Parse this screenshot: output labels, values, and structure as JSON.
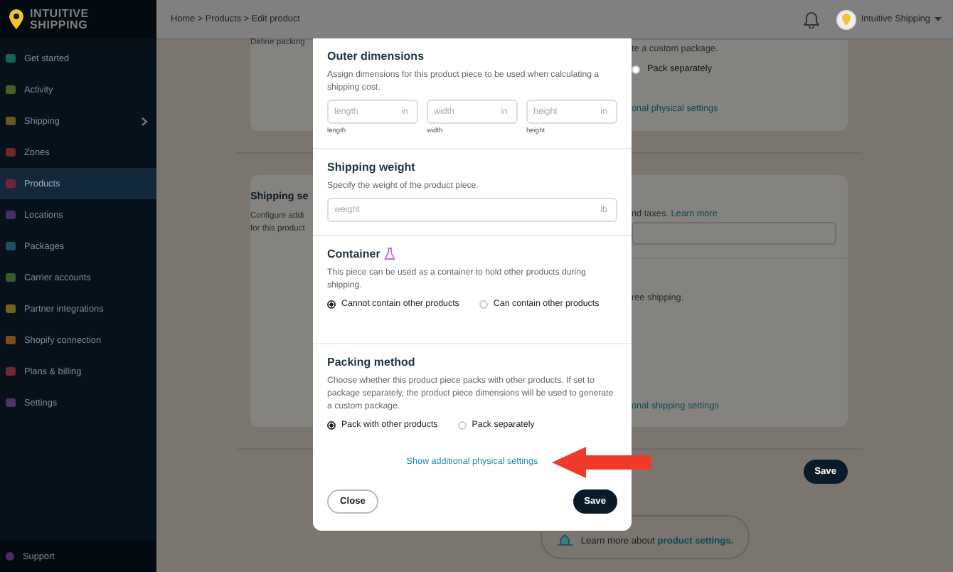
{
  "sidebar": {
    "logo": {
      "line1": "INTUITIVE",
      "line2": "SHIPPING"
    },
    "items": [
      {
        "label": "Get started",
        "selected": false,
        "expandable": false,
        "color": "#17625b"
      },
      {
        "label": "Activity",
        "selected": false,
        "expandable": false,
        "color": "#456125"
      },
      {
        "label": "Shipping",
        "selected": false,
        "expandable": true,
        "color": "#64591d"
      },
      {
        "label": "Zones",
        "selected": false,
        "expandable": false,
        "color": "#702a22"
      },
      {
        "label": "Products",
        "selected": true,
        "expandable": false,
        "color": "#70253d"
      },
      {
        "label": "Locations",
        "selected": false,
        "expandable": false,
        "color": "#472e68"
      },
      {
        "label": "Packages",
        "selected": false,
        "expandable": false,
        "color": "#1d5064"
      },
      {
        "label": "Carrier accounts",
        "selected": false,
        "expandable": false,
        "color": "#355f25"
      },
      {
        "label": "Partner integrations",
        "selected": false,
        "expandable": false,
        "color": "#72611d"
      },
      {
        "label": "Shopify connection",
        "selected": false,
        "expandable": false,
        "color": "#785018"
      },
      {
        "label": "Plans & billing",
        "selected": false,
        "expandable": false,
        "color": "#702835"
      },
      {
        "label": "Settings",
        "selected": false,
        "expandable": false,
        "color": "#503068"
      }
    ],
    "support": {
      "label": "Support",
      "color": "#4d2c68"
    }
  },
  "topbar": {
    "breadcrumb": "Home > Products > Edit product",
    "account": "Intuitive Shipping"
  },
  "page": {
    "packing_card": {
      "left_text": "Define packing",
      "right_text": "te a custom package.",
      "radio": {
        "label": "Pack separately",
        "selected": false
      },
      "link": "onal physical settings"
    },
    "shipping_card": {
      "title": "Shipping se",
      "desc_lines": [
        "Configure addi",
        "for this product"
      ],
      "right_text": "nd taxes.",
      "learn_link": "Learn more",
      "note": "ree shipping.",
      "link": "onal shipping settings"
    },
    "save": "Save",
    "help": {
      "text": "Learn more about ",
      "link": "product settings."
    }
  },
  "modal": {
    "sections": [
      {
        "kind": "fields",
        "title": "Outer dimensions",
        "title_icon": false,
        "description": "Assign dimensions for this product piece to be used when calculating a shipping cost.",
        "fields": [
          {
            "placeholder": "length",
            "unit": "in",
            "label": "length"
          },
          {
            "placeholder": "width",
            "unit": "in",
            "label": "width"
          },
          {
            "placeholder": "height",
            "unit": "in",
            "label": "height"
          }
        ]
      },
      {
        "kind": "fields",
        "title": "Shipping weight",
        "title_icon": false,
        "description": "Specify the weight of the product piece.",
        "fields": [
          {
            "placeholder": "weight",
            "unit": "lb"
          }
        ]
      },
      {
        "kind": "radios",
        "title": "Container",
        "title_icon": true,
        "description": "This piece can be used as a container to hold other products during shipping.",
        "options": [
          {
            "label": "Cannot contain other products",
            "selected": true
          },
          {
            "label": "Can contain other products",
            "selected": false
          }
        ]
      },
      {
        "kind": "radios",
        "title": "Packing method",
        "title_icon": false,
        "description": "Choose whether this product piece packs with other products. If set to package separately, the product piece dimensions will be used to generate a custom package.",
        "options": [
          {
            "label": "Pack with other products",
            "selected": true
          },
          {
            "label": "Pack separately",
            "selected": false
          }
        ]
      }
    ],
    "link": "Show additional physical settings",
    "close": "Close",
    "save": "Save"
  }
}
